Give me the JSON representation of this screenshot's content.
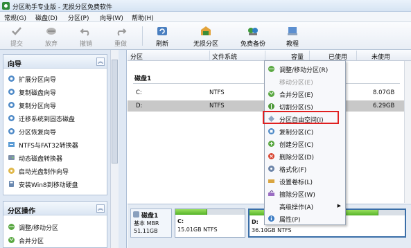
{
  "titlebar": {
    "title": "分区助手专业版 - 无损分区免费软件"
  },
  "menubar": {
    "items": [
      "常规(G)",
      "磁盘(D)",
      "分区(P)",
      "向导(W)",
      "帮助(H)"
    ]
  },
  "toolbar": {
    "buttons": [
      {
        "label": "提交",
        "icon": "check-icon",
        "enabled": false
      },
      {
        "label": "放弃",
        "icon": "discard-icon",
        "enabled": false
      },
      {
        "label": "撤销",
        "icon": "undo-icon",
        "enabled": false
      },
      {
        "label": "重做",
        "icon": "redo-icon",
        "enabled": false
      },
      {
        "label": "刷新",
        "icon": "refresh-icon",
        "enabled": true
      },
      {
        "label": "无损分区",
        "icon": "partition-icon",
        "enabled": true
      },
      {
        "label": "免费备份",
        "icon": "backup-icon",
        "enabled": true
      },
      {
        "label": "教程",
        "icon": "tutorial-icon",
        "enabled": true
      }
    ]
  },
  "sidebar": {
    "wizard": {
      "title": "向导",
      "items": [
        "扩展分区向导",
        "复制磁盘向导",
        "复制分区向导",
        "迁移系统到固态磁盘",
        "分区恢复向导",
        "NTFS与FAT32转换器",
        "动态磁盘转换器",
        "启动光盘制作向导",
        "安装Win8到移动硬盘"
      ]
    },
    "ops": {
      "title": "分区操作",
      "items": [
        "调整/移动分区",
        "合并分区"
      ]
    }
  },
  "table": {
    "columns": [
      "分区",
      "文件系统",
      "容量",
      "已使用",
      "未使用"
    ],
    "disk_label": "磁盘1",
    "rows": [
      {
        "partition": "C:",
        "fs": "NTFS",
        "unused": "8.07GB"
      },
      {
        "partition": "D:",
        "fs": "NTFS",
        "unused": "6.29GB"
      }
    ]
  },
  "diskmap": {
    "disk": {
      "title": "磁盘1",
      "type": "基本 MBR",
      "size": "51.11GB"
    },
    "partitions": [
      {
        "letter": "C:",
        "info": "15.01GB NTFS",
        "used_fraction": 0.46
      },
      {
        "letter": "D:",
        "info": "36.10GB NTFS",
        "used_fraction": 0.83
      }
    ]
  },
  "context_menu": {
    "items": [
      {
        "label": "调整/移动分区(R)",
        "icon": "resize-icon",
        "enabled": true
      },
      {
        "label": "移动分区(E)",
        "icon": "move-icon",
        "enabled": false
      },
      {
        "label": "合并分区(E)",
        "icon": "merge-icon",
        "enabled": true
      },
      {
        "label": "切割分区(S)",
        "icon": "split-icon",
        "enabled": true
      },
      {
        "label": "分区自由空间(I)",
        "icon": "free-space-icon",
        "enabled": true
      },
      {
        "label": "复制分区(C)",
        "icon": "copy-icon",
        "enabled": true
      },
      {
        "label": "创建分区(C)",
        "icon": "create-icon",
        "enabled": true
      },
      {
        "label": "删除分区(D)",
        "icon": "delete-icon",
        "enabled": true
      },
      {
        "label": "格式化(F)",
        "icon": "format-icon",
        "enabled": true
      },
      {
        "label": "设置卷标(L)",
        "icon": "label-icon",
        "enabled": true
      },
      {
        "label": "擦除分区(W)",
        "icon": "wipe-icon",
        "enabled": true
      },
      {
        "label": "高级操作(A)",
        "icon": "advanced-icon",
        "enabled": true,
        "submenu": true
      },
      {
        "label": "属性(P)",
        "icon": "info-icon",
        "enabled": true
      }
    ],
    "highlighted_index": 4
  },
  "colors": {
    "accent": "#3a6ea8",
    "highlight_border": "#e02020",
    "bar_green": "#55b329"
  }
}
